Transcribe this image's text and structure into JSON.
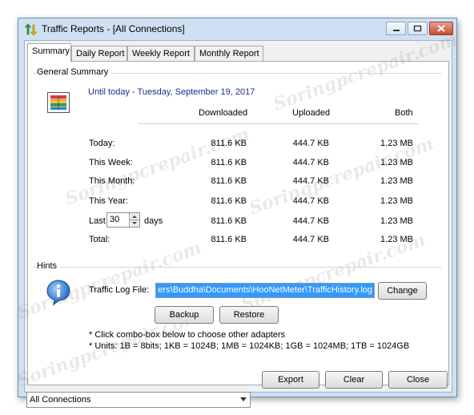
{
  "window": {
    "title": "Traffic Reports - [All Connections]",
    "app_icon": "traffic-arrows-icon"
  },
  "tabs": [
    {
      "label": "Summary",
      "active": true
    },
    {
      "label": "Daily Report",
      "active": false
    },
    {
      "label": "Weekly Report",
      "active": false
    },
    {
      "label": "Monthly Report",
      "active": false
    }
  ],
  "general_summary": {
    "group_label": "General Summary",
    "date_line": "Until today - Tuesday, September 19, 2017",
    "columns": [
      "Downloaded",
      "Uploaded",
      "Both"
    ],
    "rows": [
      {
        "label": "Today:",
        "downloaded": "811.6 KB",
        "uploaded": "444.7 KB",
        "both": "1.23 MB"
      },
      {
        "label": "This Week:",
        "downloaded": "811.6 KB",
        "uploaded": "444.7 KB",
        "both": "1.23 MB"
      },
      {
        "label": "This Month:",
        "downloaded": "811.6 KB",
        "uploaded": "444.7 KB",
        "both": "1.23 MB"
      },
      {
        "label": "This Year:",
        "downloaded": "811.6 KB",
        "uploaded": "444.7 KB",
        "both": "1.23 MB"
      },
      {
        "label": "Last",
        "downloaded": "811.6 KB",
        "uploaded": "444.7 KB",
        "both": "1.23 MB"
      },
      {
        "label": "Total:",
        "downloaded": "811.6 KB",
        "uploaded": "444.7 KB",
        "both": "1.23 MB"
      }
    ],
    "last_days_value": "30",
    "last_days_suffix": "days"
  },
  "hints": {
    "group_label": "Hints",
    "log_file_label": "Traffic Log File:",
    "log_file_path": "ers\\Buddha\\Documents\\HooNetMeter\\TrafficHistory.log",
    "change_label": "Change",
    "backup_label": "Backup",
    "restore_label": "Restore",
    "note1": "* Click combo-box below to choose other adapters",
    "note2": "* Units: 1B = 8bits; 1KB = 1024B; 1MB = 1024KB; 1GB = 1024MB; 1TB = 1024GB"
  },
  "footer": {
    "adapter_selected": "All Connections",
    "export_label": "Export",
    "clear_label": "Clear",
    "close_label": "Close"
  },
  "watermark_text": "Soringpcrepair.com",
  "colors": {
    "date_text": "#1b2b8c",
    "selection": "#3399ff",
    "window_frame": "#cfe0f2"
  }
}
